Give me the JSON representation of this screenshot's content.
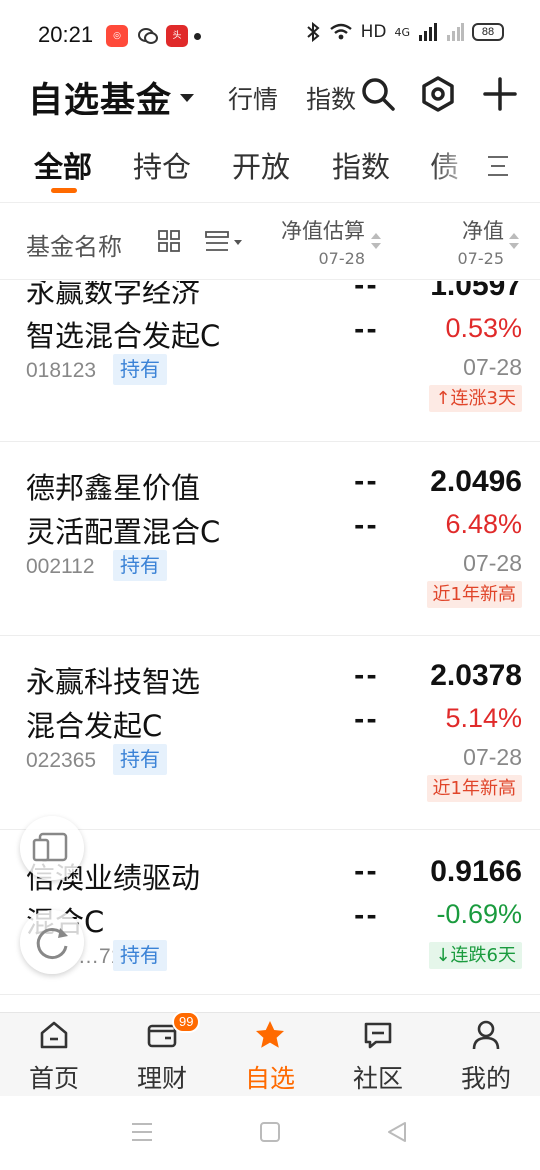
{
  "status_bar": {
    "time": "20:21",
    "network": "HD",
    "signal_label": "4G",
    "battery": "88",
    "app_icons": [
      {
        "name": "shopping-app-icon",
        "color": "#ff4a3a"
      },
      {
        "name": "wechat-icon",
        "color": "#333333"
      },
      {
        "name": "toutiao-news-icon",
        "color": "#e02a2a"
      }
    ]
  },
  "header": {
    "title": "自选基金",
    "market_link": "行情",
    "index_link": "指数"
  },
  "tabs": [
    {
      "label": "全部",
      "active": true
    },
    {
      "label": "持仓",
      "active": false
    },
    {
      "label": "开放",
      "active": false
    },
    {
      "label": "指数",
      "active": false
    },
    {
      "label": "债",
      "active": false
    }
  ],
  "columns": {
    "name": "基金名称",
    "estimate": "净值估算",
    "estimate_date": "07-28",
    "nav": "净值",
    "nav_date": "07-25"
  },
  "funds": [
    {
      "name_line1": "永赢数字经济",
      "name_line2": "智选混合发起C",
      "code": "018123",
      "held": true,
      "hold_label": "持有",
      "est1": "--",
      "est2": "--",
      "nav": "1.0597",
      "change": "0.53%",
      "direction": "up",
      "date": "07-28",
      "badge": "连涨3天",
      "badge_arrow": true
    },
    {
      "name_line1": "德邦鑫星价值",
      "name_line2": "灵活配置混合C",
      "code": "002112",
      "held": true,
      "hold_label": "持有",
      "est1": "--",
      "est2": "--",
      "nav": "2.0496",
      "change": "6.48%",
      "direction": "up",
      "date": "07-28",
      "badge": "近1年新高",
      "badge_arrow": false
    },
    {
      "name_line1": "永赢科技智选",
      "name_line2": "混合发起C",
      "code": "022365",
      "held": true,
      "hold_label": "持有",
      "est1": "--",
      "est2": "--",
      "nav": "2.0378",
      "change": "5.14%",
      "direction": "up",
      "date": "07-28",
      "badge": "近1年新高",
      "badge_arrow": false
    },
    {
      "name_line1": "信澳业绩驱动",
      "name_line2": "混合C",
      "code": "…71",
      "held": true,
      "hold_label": "持有",
      "est1": "--",
      "est2": "--",
      "nav": "0.9166",
      "change": "-0.69%",
      "direction": "down",
      "date": "",
      "badge": "连跌6天",
      "badge_arrow": true
    }
  ],
  "bottom_nav": [
    {
      "label": "首页",
      "icon": "home-icon",
      "active": false
    },
    {
      "label": "理财",
      "icon": "wallet-icon",
      "active": false,
      "badge": "99"
    },
    {
      "label": "自选",
      "icon": "star-icon",
      "active": true
    },
    {
      "label": "社区",
      "icon": "chat-bubble-icon",
      "active": false
    },
    {
      "label": "我的",
      "icon": "user-icon",
      "active": false
    }
  ],
  "colors": {
    "accent": "#ff6a00",
    "up": "#e02a2a",
    "down": "#1a9b3e",
    "hold_tag_bg": "#e6f1fc",
    "hold_tag_text": "#3a82d6"
  }
}
